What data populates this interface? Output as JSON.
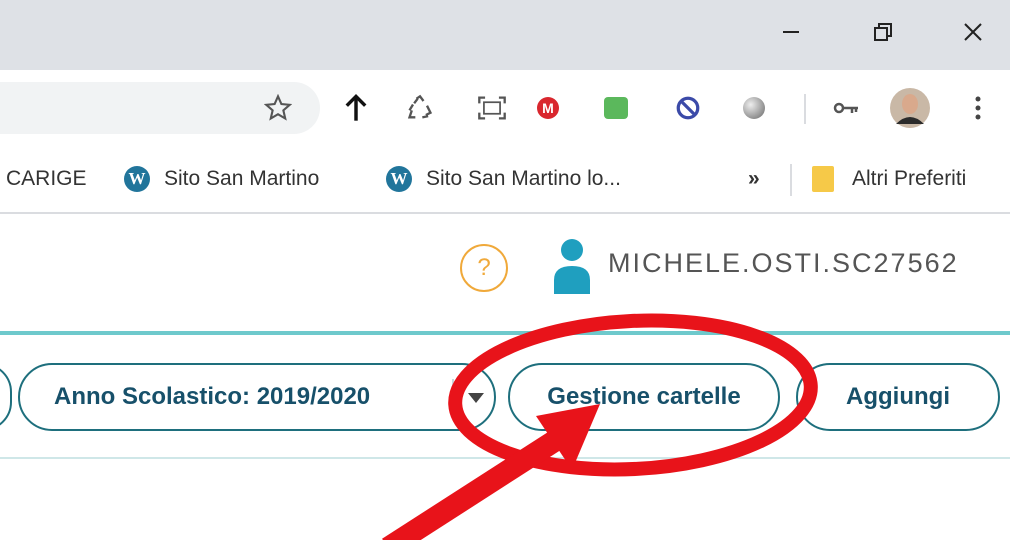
{
  "window": {
    "minimize_icon": "minimize-icon",
    "restore_icon": "restore-icon",
    "close_icon": "close-icon"
  },
  "toolbar": {
    "icons": [
      "star-icon",
      "upload-arrow-icon",
      "recycle-icon",
      "screenshot-icon",
      "mega-icon",
      "green-extension-icon",
      "block-icon",
      "sphere-icon",
      "key-icon",
      "profile-avatar",
      "menu-dots-icon"
    ],
    "mega_letter": "M"
  },
  "bookmarks": {
    "items": [
      {
        "label": "CARIGE"
      },
      {
        "label": "Sito San Martino",
        "icon": "wordpress-icon"
      },
      {
        "label": "Sito San Martino lo..."
      }
    ],
    "overflow": "»",
    "other": "Altri Preferiti",
    "wp_letter": "W"
  },
  "header": {
    "help": "?",
    "username": "MICHELE.OSTI.SC27562"
  },
  "actions": {
    "school_year": "Anno Scolastico: 2019/2020",
    "manage_folders": "Gestione cartelle",
    "add": "Aggiungi"
  },
  "colors": {
    "accent": "#1e6f7d",
    "teal_line": "#6ec9cc",
    "help": "#f0a93a",
    "annotation": "#e8131a"
  }
}
